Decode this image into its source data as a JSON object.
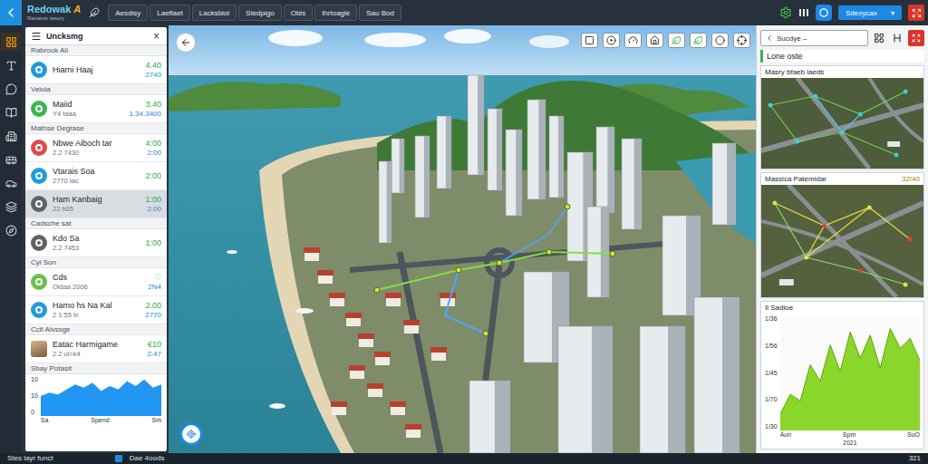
{
  "app": {
    "logo": "Redowak",
    "logo_mark": "A",
    "logo_subtitle": "Ravatvis tasury"
  },
  "top_tabs": [
    {
      "label": "Aesdisy",
      "selected": false
    },
    {
      "label": "Laeflaet",
      "selected": false
    },
    {
      "label": "Lacksbioi",
      "selected": false
    },
    {
      "label": "Stedpigo",
      "selected": false
    },
    {
      "label": "Obis",
      "selected": false
    },
    {
      "label": "Ihrtoagle",
      "selected": false
    },
    {
      "label": "Sau Bod",
      "selected": false
    }
  ],
  "top_actions": {
    "account_button": "Sdexycax",
    "account_caret": "▾"
  },
  "rail": [
    {
      "selected": true
    },
    {
      "selected": false
    },
    {
      "selected": false
    },
    {
      "selected": false
    },
    {
      "selected": false
    },
    {
      "selected": false
    },
    {
      "selected": false
    },
    {
      "selected": false
    },
    {
      "selected": false
    }
  ],
  "left_panel": {
    "title": "Uncksmg",
    "close": "×",
    "groups": [
      {
        "title": "Rabrook Ali",
        "items": [
          {
            "kind": "badge",
            "name": "Hiarni Haaj",
            "value": "4.40",
            "value2": "2740",
            "color": "#1e9be0",
            "selected": false
          }
        ]
      },
      {
        "title": "Veioia",
        "items": [
          {
            "kind": "badge",
            "name": "Maiid",
            "sub": "Y4 taaa",
            "value": "3.40",
            "value2": "1.34.3400",
            "color": "#3cb54a",
            "selected": false
          }
        ]
      },
      {
        "title": "Mathse Degrase",
        "items": [
          {
            "kind": "badge",
            "name": "Nbwe Aiboch tar",
            "sub": "2.2 7430",
            "value": "4:00",
            "value2": "2:00",
            "color": "#e04a4a",
            "selected": false
          },
          {
            "kind": "badge",
            "name": "Vtarais Soa",
            "sub": "2770 Iac",
            "value": "2:00",
            "color": "#1e9be0",
            "selected": false
          },
          {
            "kind": "badge",
            "name": "Ham Kanbaig",
            "sub": "22 h05",
            "value": "1:00",
            "value2": "2:00",
            "color": "#5f6368",
            "selected": true
          }
        ]
      },
      {
        "title": "Cadsche sat",
        "items": [
          {
            "kind": "badge",
            "name": "Kdo Sa",
            "sub": "2.2 7453",
            "value": "1:00",
            "color": "#5f6368",
            "selected": false
          }
        ]
      },
      {
        "title": "Cyl Son",
        "items": [
          {
            "kind": "badge",
            "name": "Cds",
            "sub": "Oldaa 2006",
            "value": "♡",
            "value2": "2N4",
            "color": "#6cc04a",
            "selected": false
          },
          {
            "kind": "badge",
            "name": "Hamo hs Na Kal",
            "sub": "2 1:55 ln",
            "value": "2.00",
            "value2": "2770",
            "color": "#1e9be0",
            "selected": false
          }
        ]
      },
      {
        "title": "Cctl Alvssge",
        "items": [
          {
            "kind": "photo",
            "name": "Eatac Harmigame",
            "sub": "2.2 ui=k4",
            "value": "€10",
            "value2": "2.47",
            "color": "#7a5a40",
            "selected": false
          }
        ]
      }
    ],
    "chart": {
      "title": "Sbay Potasit",
      "y_ticks": [
        "10",
        "10",
        "0"
      ],
      "x_labels": [
        "Sa",
        "Spend",
        "Sm"
      ],
      "values": [
        6,
        7,
        6.5,
        8,
        9.5,
        8.5,
        10,
        7.5,
        9,
        8,
        10.5,
        9,
        11,
        8.5,
        9.5
      ]
    }
  },
  "map": {
    "tools": [
      {
        "active": false
      },
      {
        "active": false
      },
      {
        "active": false
      },
      {
        "active": false
      },
      {
        "active": true
      },
      {
        "active": true
      },
      {
        "active": false
      },
      {
        "active": false
      }
    ]
  },
  "right_panel": {
    "search_placeholder": "Sucdye –",
    "title": "Lone oste",
    "cards": [
      {
        "title": "Masry bfaeb laeds"
      },
      {
        "title": "Massica Patemidar",
        "value": "32/40"
      }
    ],
    "chart": {
      "title": "Il Sadioe",
      "y_ticks": [
        "1/36",
        "1/56",
        "1/45",
        "1/70",
        "1/30"
      ],
      "x_labels": [
        "Aun",
        "Spm",
        "SuO"
      ],
      "year": "2021",
      "values": [
        10,
        22,
        18,
        40,
        30,
        52,
        36,
        60,
        44,
        58,
        38,
        62,
        50,
        56,
        42
      ]
    }
  },
  "status_bar": {
    "left": "Stes layr funct",
    "middle": "Dae 4oods",
    "right": "321"
  }
}
